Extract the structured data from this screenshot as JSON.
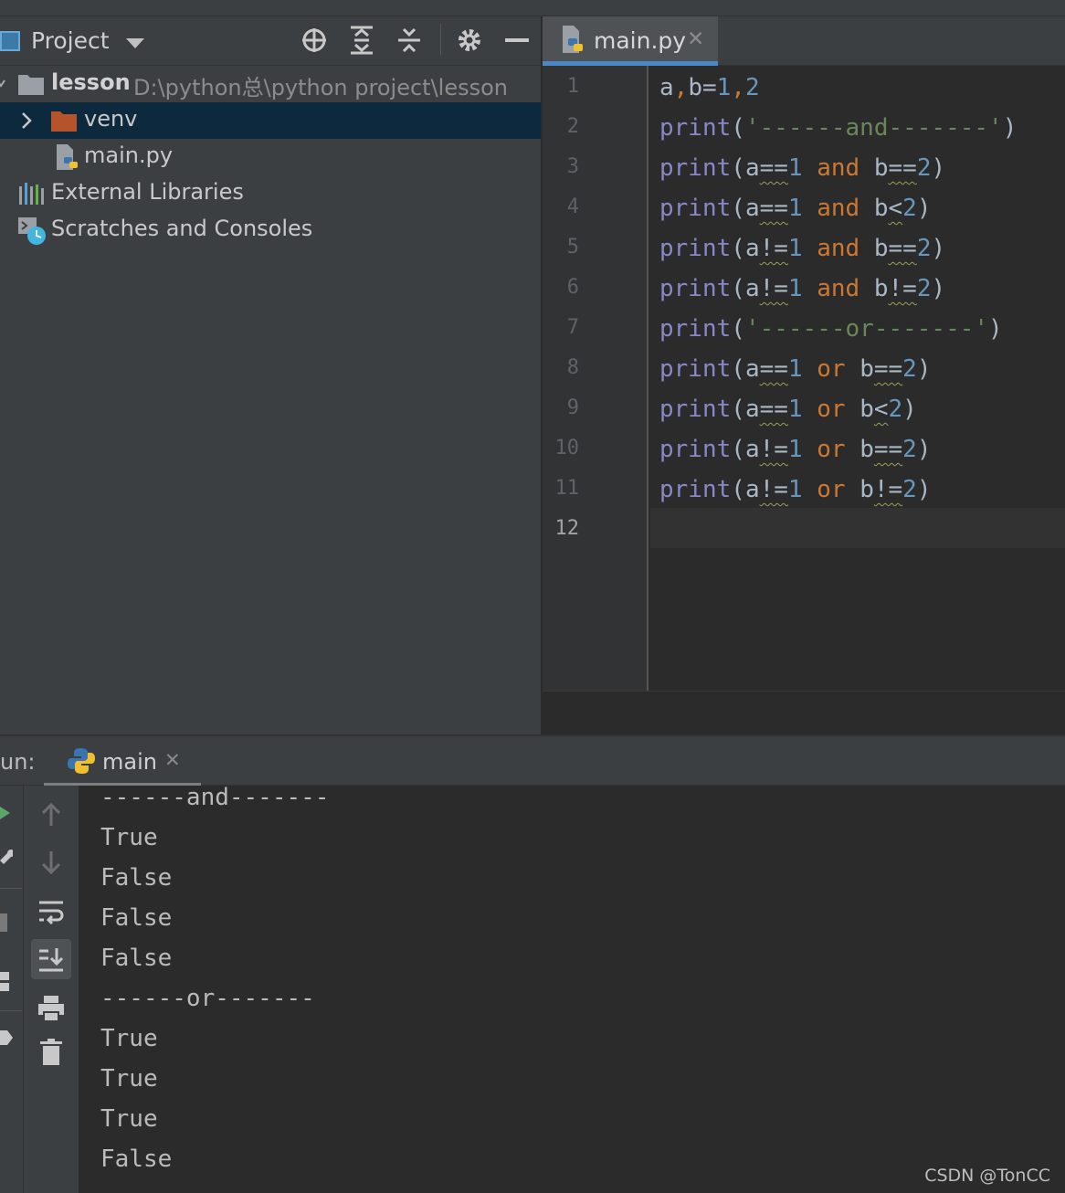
{
  "project": {
    "title": "Project",
    "root": {
      "name": "lesson",
      "path": "D:\\python总\\python project\\lesson"
    },
    "items": [
      "venv",
      "main.py"
    ],
    "external": "External Libraries",
    "scratches": "Scratches and Consoles"
  },
  "editor": {
    "tab": {
      "label": "main.py",
      "close": "✕"
    },
    "line_numbers": [
      "1",
      "2",
      "3",
      "4",
      "5",
      "6",
      "7",
      "8",
      "9",
      "10",
      "11",
      "12"
    ],
    "code": [
      "a,b=1,2",
      "print('------and-------')",
      "print(a==1 and b==2)",
      "print(a==1 and b<2)",
      "print(a!=1 and b==2)",
      "print(a!=1 and b!=2)",
      "print('------or-------')",
      "print(a==1 or b==2)",
      "print(a==1 or b<2)",
      "print(a!=1 or b==2)",
      "print(a!=1 or b!=2)",
      ""
    ]
  },
  "run": {
    "label": "un:",
    "tab": {
      "label": "main",
      "close": "✕"
    },
    "output": [
      "------and-------",
      "True",
      "False",
      "False",
      "False",
      "------or-------",
      "True",
      "True",
      "True",
      "False"
    ]
  },
  "watermark": "CSDN @TonCC",
  "colors": {
    "keyword": "#cc7832",
    "builtin": "#8888c6",
    "number": "#6897bb",
    "string": "#6a8759",
    "selection": "#0d293e",
    "accent": "#4a88c7"
  },
  "icons": [
    "project-icon",
    "dropdown-icon",
    "locate-icon",
    "expand-all-icon",
    "collapse-all-icon",
    "gear-icon",
    "minimize-icon",
    "chevron-right-icon",
    "folder-icon",
    "python-file-icon",
    "libraries-icon",
    "scratches-icon",
    "python-icon",
    "close-icon",
    "rerun-icon",
    "wrench-icon",
    "stop-icon",
    "layout-icon",
    "pin-icon",
    "up-arrow-icon",
    "down-arrow-icon",
    "soft-wrap-icon",
    "scroll-to-end-icon",
    "print-icon",
    "trash-icon"
  ]
}
